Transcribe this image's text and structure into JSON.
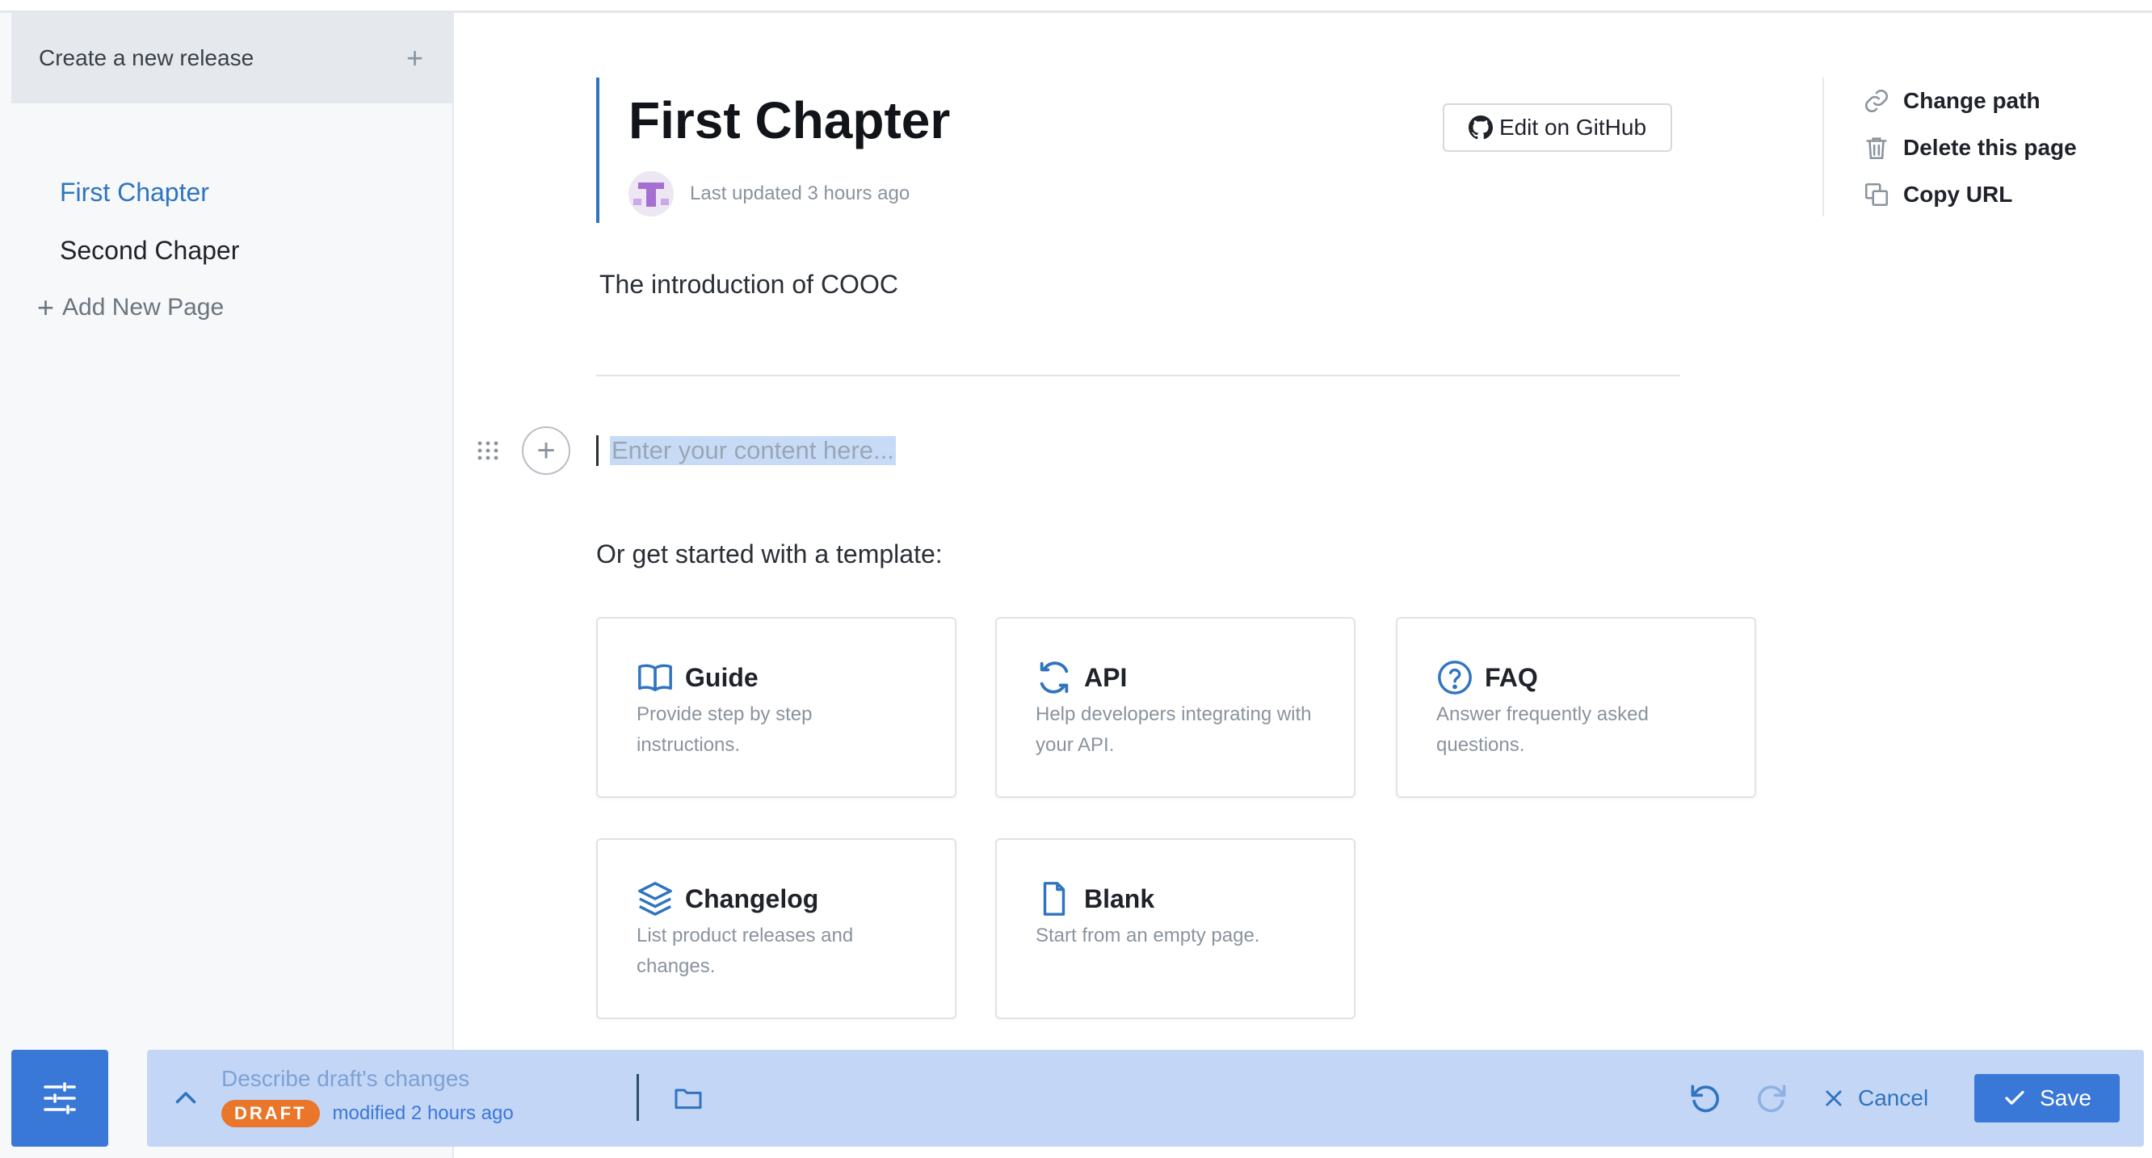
{
  "sidebar": {
    "release_label": "Create a new release",
    "release_plus": "+",
    "pages": [
      {
        "label": "First Chapter",
        "active": true
      },
      {
        "label": "Second Chaper",
        "active": false
      }
    ],
    "add_page_icon": "+",
    "add_page_label": "Add New Page"
  },
  "page": {
    "title": "First Chapter",
    "last_updated": "Last updated 3 hours ago",
    "edit_github_label": "Edit on GitHub",
    "intro": "The introduction of COOC"
  },
  "actions": [
    {
      "label": "Change path",
      "icon": "link-icon"
    },
    {
      "label": "Delete this page",
      "icon": "trash-icon"
    },
    {
      "label": "Copy URL",
      "icon": "copy-icon"
    }
  ],
  "editor": {
    "add_block_icon": "+",
    "placeholder": "Enter your content here..."
  },
  "templates": {
    "heading": "Or get started with a template:",
    "items": [
      {
        "title": "Guide",
        "desc_line1": "Provide step by step",
        "desc_line2": "instructions.",
        "icon": "book-icon"
      },
      {
        "title": "API",
        "desc_line1": "Help developers integrating with",
        "desc_line2": "your API.",
        "icon": "sync-icon"
      },
      {
        "title": "FAQ",
        "desc_line1": "Answer frequently asked",
        "desc_line2": "questions.",
        "icon": "question-circle-icon"
      },
      {
        "title": "Changelog",
        "desc_line1": "List product releases and",
        "desc_line2": "changes.",
        "icon": "layers-icon"
      },
      {
        "title": "Blank",
        "desc_line1": "Start from an empty page.",
        "desc_line2": "",
        "icon": "file-icon"
      }
    ]
  },
  "draft_bar": {
    "describe_label": "Describe draft's changes",
    "badge": "DRAFT",
    "modified": "modified 2 hours ago",
    "cancel_label": "Cancel",
    "save_label": "Save"
  },
  "colors": {
    "accent": "#2f74c0",
    "primary_button": "#3a78d8",
    "draft_bar": "#c4d6f5",
    "draft_badge": "#e9762b"
  }
}
